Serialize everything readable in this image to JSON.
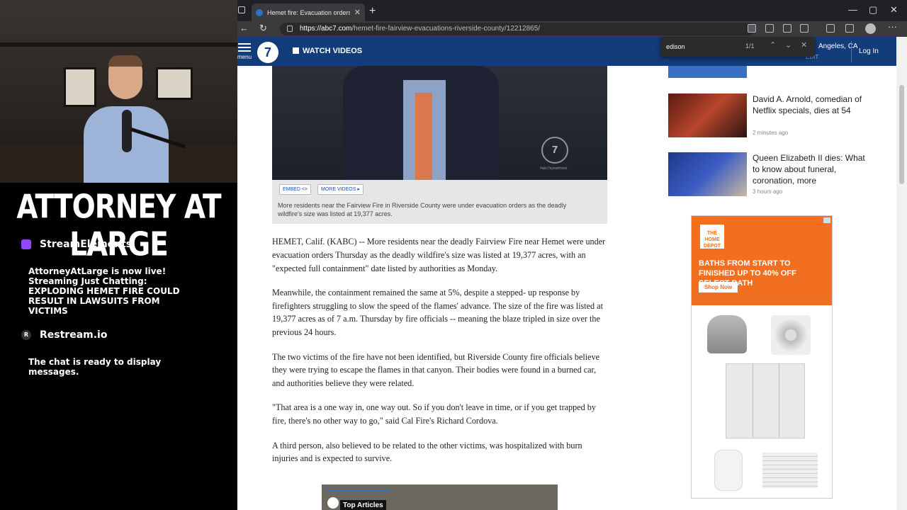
{
  "overlay": {
    "banner": "ATTORNEY AT LARGE",
    "chat": [
      {
        "source": "StreamElements",
        "icon": "twitch-icon",
        "message": "AttorneyAtLarge is now live! Streaming Just Chatting: EXPLODING HEMET FIRE COULD RESULT IN LAWSUITS FROM VICTIMS"
      },
      {
        "source": "Restream.io",
        "icon": "restream-icon",
        "message": "The chat is ready to display messages."
      }
    ]
  },
  "browser": {
    "tab_title": "Hemet fire: Evacuation orders e",
    "url_host": "https://abc7.com",
    "url_path": "/hemet-fire-fairview-evacuations-riverside-county/12212865/",
    "find": {
      "query": "edison",
      "count": "1/1"
    }
  },
  "site": {
    "menu_label": "menu",
    "logo_text": "7",
    "watch_videos": "WATCH VIDEOS",
    "location": "Angeles, CA",
    "edit": "EDIT",
    "login": "Log In",
    "brand_color": "#123c7a"
  },
  "video": {
    "watermark": "7",
    "watermark_tag": "#abc7eyewitness",
    "embed_label": "EMBED <>",
    "more_videos_label": "MORE VIDEOS ▸",
    "caption": "More residents near the Fairview Fire in Riverside County were under evacuation orders as the deadly wildfire's size was listed at 19,377 acres."
  },
  "article": {
    "paragraphs": [
      "HEMET, Calif. (KABC) -- More residents near the deadly Fairview Fire near Hemet were under evacuation orders Thursday as the deadly wildfire's size was listed at 19,377 acres, with an \"expected full containment\" date listed by authorities as Monday.",
      "Meanwhile, the containment remained the same at 5%, despite a stepped- up response by firefighters struggling to slow the speed of the flames' advance. The size of the fire was listed at 19,377 acres as of 7 a.m. Thursday by fire officials -- meaning the blaze tripled in size over the previous 24 hours.",
      "The two victims of the fire have not been identified, but Riverside County fire officials believe they were trying to escape the flames in that canyon. Their bodies were found in a burned car, and authorities believe they were related.",
      "\"That area is a one way in, one way out. So if you don't leave in time, or if you get trapped by fire, there's no other way to go,\" said Cal Fire's Richard Cordova.",
      "A third person, also believed to be related to the other victims, was hospitalized with burn injuries and is expected to survive."
    ],
    "top_articles_label": "Top Articles"
  },
  "rail": {
    "items": [
      {
        "title": "David A. Arnold, comedian of Netflix specials, dies at 54",
        "time": "2 minutes ago"
      },
      {
        "title": "Queen Elizabeth II dies: What to know about funeral, coronation, more",
        "time": "3 hours ago"
      }
    ]
  },
  "ad": {
    "brand": "THE HOME DEPOT",
    "headline": "BATHS FROM START TO FINISHED UP TO 40% OFF SELECT BATH",
    "cta": "Shop Now",
    "accent": "#f26f1f"
  }
}
